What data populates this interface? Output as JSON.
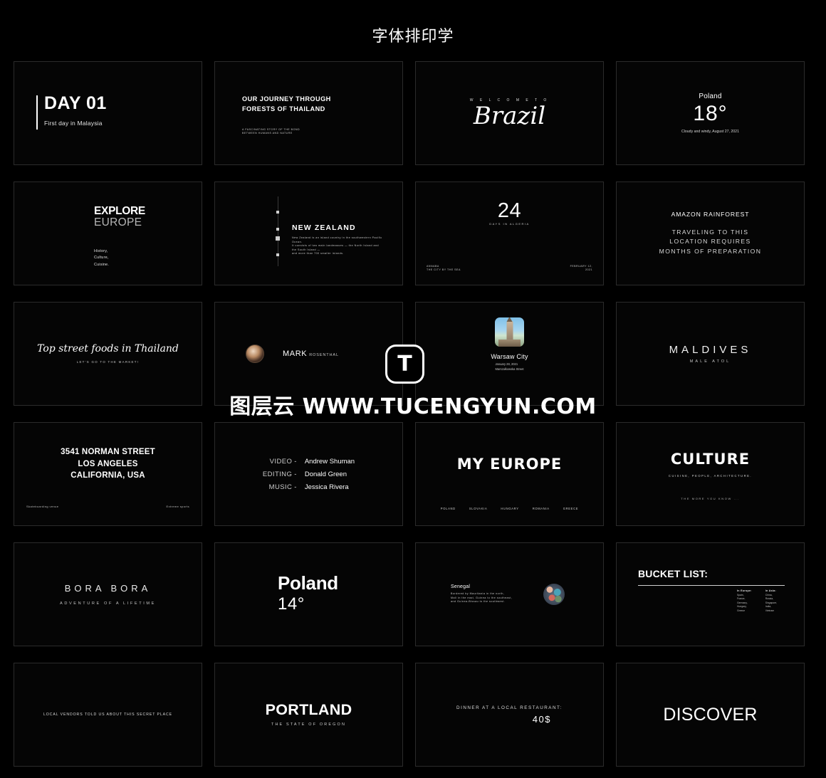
{
  "header": {
    "title": "字体排印学"
  },
  "watermark": {
    "logo_letter": "T",
    "text": "图层云 WWW.TUCENGYUN.COM"
  },
  "cards": {
    "day01": {
      "title": "DAY 01",
      "subtitle": "First day in Malaysia"
    },
    "journey": {
      "line1": "OUR JOURNEY THROUGH",
      "line2": "FORESTS OF THAILAND",
      "sub1": "A FASCINATING STORY OF THE BOND",
      "sub2": "BETWEEN HUMANS AND NATURE"
    },
    "brazil": {
      "kicker": "W E L C O M E   T O",
      "title": "Brazil"
    },
    "weather1": {
      "place": "Poland",
      "temp": "18°",
      "detail": "Cloudy and windy, August 27, 2021"
    },
    "explore": {
      "line1": "EXPLORE",
      "line2": "EUROPE",
      "list1": "History,",
      "list2": "Culture,",
      "list3": "Cuisine."
    },
    "newzealand": {
      "title": "NEW ZEALAND",
      "desc1": "New Zealand is an island country in the southwestern Pacific Ocean.",
      "desc2": "It consists of two main landmasses — the North Island and the South Island —",
      "desc3": "and more than 700 smaller islands."
    },
    "algeria": {
      "number": "24",
      "caption": "DAYS IN ALGERIA",
      "foot_left1": "ANNABA",
      "foot_left2": "THE CITY BY THE SEA",
      "foot_right1": "FEBRUARY 12,",
      "foot_right2": "2021"
    },
    "amazon": {
      "title": "AMAZON RAINFOREST",
      "line1": "TRAVELING TO THIS",
      "line2": "LOCATION REQUIRES",
      "line3": "MONTHS OF PREPARATION"
    },
    "street": {
      "title": "Top street foods in Thailand",
      "subtitle": "LET'S GO TO THE MARKET!"
    },
    "mark": {
      "first": "MARK",
      "last": "ROSENTHAL"
    },
    "warsaw": {
      "title": "Warsaw City",
      "date": "January 28, 2021",
      "street": "Marszalkowska Street"
    },
    "maldives": {
      "title": "MALDIVES",
      "subtitle": "MALE ATOL"
    },
    "address": {
      "line1": "3541 NORMAN STREET",
      "line2": "LOS ANGELES",
      "line3": "CALIFORNIA, USA",
      "foot_left": "Skateboarding venue",
      "foot_right": "Extreme sports"
    },
    "credits": {
      "rows": [
        {
          "role": "VIDEO -",
          "name": "Andrew Shuman"
        },
        {
          "role": "EDITING -",
          "name": "Donald Green"
        },
        {
          "role": "MUSIC -",
          "name": "Jessica Rivera"
        }
      ]
    },
    "myeurope": {
      "title": "MY EUROPE",
      "tags": [
        "POLAND",
        "SLOVAKIA",
        "HUNGARY",
        "ROMANIA",
        "GREECE"
      ]
    },
    "culture": {
      "title": "CULTURE",
      "subtitle": "CUISINE, PEOPLE, ARCHITECTURE.",
      "footer": "THE MORE YOU KNOW ..."
    },
    "bora": {
      "title": "BORA BORA",
      "subtitle": "ADVENTURE OF A LIFETIME"
    },
    "weather2": {
      "place": "Poland",
      "temp": "14°"
    },
    "senegal": {
      "title": "Senegal",
      "desc1": "Bordered by Mauritania in the north,",
      "desc2": "Mali in the east, Guinea to the southeast,",
      "desc3": "and Guinea-Bissau to the southwest."
    },
    "bucket": {
      "title": "BUCKET LIST:",
      "col1_header": "In Europe:",
      "col1_items": "Spain,\nFrance,\nGermany,\nHungary,\nGreece",
      "col2_header": "In Asia:",
      "col2_items": "China,\nRussia,\nSingapore,\nIndia,\nVietnam"
    },
    "vendors": {
      "text": "LOCAL VENDORS TOLD US ABOUT THIS SECRET PLACE"
    },
    "portland": {
      "title": "PORTLAND",
      "subtitle": "THE STATE OF OREGON"
    },
    "dinner": {
      "label": "DINNER AT A LOCAL RESTAURANT:",
      "price": "40$"
    },
    "discover": {
      "title": "DISCOVER"
    }
  }
}
